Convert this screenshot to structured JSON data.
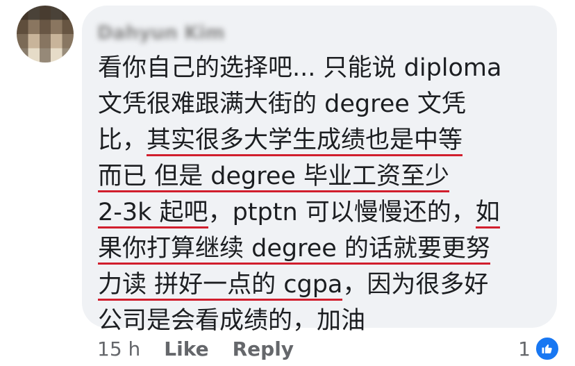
{
  "author": {
    "name": "Dahyun Kim"
  },
  "comment": {
    "lines": [
      [
        {
          "t": "看你自己的选择吧... 只能说 diploma",
          "u": false
        }
      ],
      [
        {
          "t": "文凭很难跟满大街的 degree 文凭",
          "u": false
        }
      ],
      [
        {
          "t": "比，",
          "u": false
        },
        {
          "t": "其实很多大学生成绩也是中等",
          "u": true
        }
      ],
      [
        {
          "t": "而已 但是 degree 毕业工资至少",
          "u": true
        }
      ],
      [
        {
          "t": "2-3k 起吧",
          "u": true
        },
        {
          "t": "，ptptn 可以慢慢还的，",
          "u": false
        },
        {
          "t": "如",
          "u": true
        }
      ],
      [
        {
          "t": "果你打算继续 degree 的话就要更努",
          "u": true
        }
      ],
      [
        {
          "t": "力读 拼好一点的 cgpa",
          "u": true
        },
        {
          "t": "，因为很多好",
          "u": false
        }
      ],
      [
        {
          "t": "公司是会看成绩的，加油",
          "u": false
        }
      ]
    ]
  },
  "meta": {
    "time": "15 h",
    "like_label": "Like",
    "reply_label": "Reply",
    "reaction_count": "1",
    "reaction_icon": "thumbs-up-icon",
    "accent_color": "#1877f2",
    "underline_color": "#d11e2d"
  }
}
